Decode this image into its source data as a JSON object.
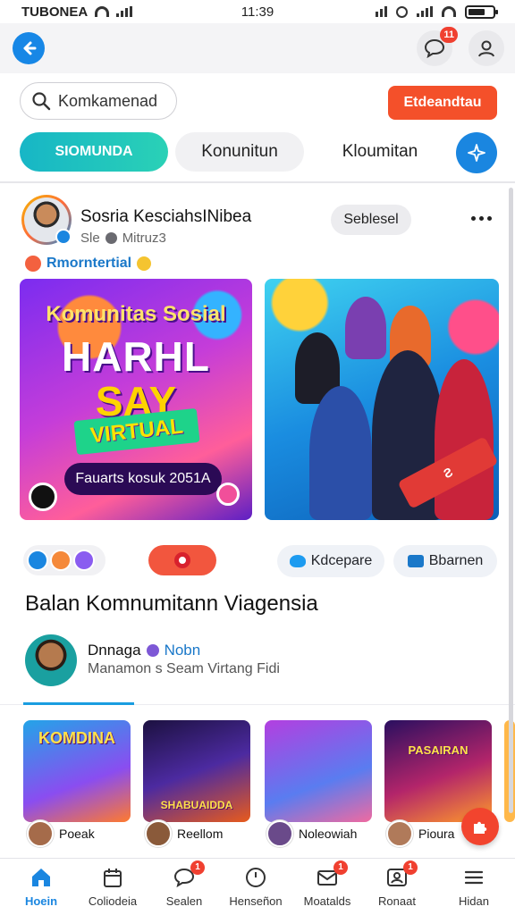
{
  "status_bar": {
    "carrier": "TUBONEA",
    "time": "11:39"
  },
  "header": {
    "notification_count": "11"
  },
  "search": {
    "placeholder": "Komkamenad"
  },
  "cta": {
    "label": "Etdeandtau"
  },
  "tabs": [
    {
      "label": "SIOMUNDA",
      "active": true
    },
    {
      "label": "Konunitun",
      "active": false
    },
    {
      "label": "Kloumitan",
      "active": false
    }
  ],
  "post": {
    "author": "Sosria KesciahsINibea",
    "subtitle_prefix": "Sle",
    "subtitle_suffix": "Mitruz3",
    "follow_label": "Seblesel",
    "tagline": "Rmorntertial",
    "poster": {
      "line1": "Komunitas Sosial",
      "line2": "HARHL",
      "line3": "SAY",
      "ribbon": "VIRTUAL",
      "date": "Fauarts kosuk 2051A"
    },
    "share_1": "Kdcepare",
    "share_2": "Bbarnen"
  },
  "section": {
    "title": "Balan Komnumitann Viagensia",
    "creator_name": "Dnnaga",
    "creator_handle": "Nobn",
    "creator_desc": "Manamon s Seam Virtang Fidi"
  },
  "thumbnails": [
    {
      "title": "KOMDINA",
      "user": "Poeak"
    },
    {
      "title": "SHABUAIDDA",
      "user": "Reellom"
    },
    {
      "title": "",
      "user": "Noleowiah"
    },
    {
      "title": "PASAIRAN",
      "user": "Pioura"
    }
  ],
  "bottom_nav": [
    {
      "label": "Hoein",
      "active": true,
      "badge": ""
    },
    {
      "label": "Coliodeia",
      "active": false,
      "badge": ""
    },
    {
      "label": "Sealen",
      "active": false,
      "badge": "1"
    },
    {
      "label": "Henseñon",
      "active": false,
      "badge": ""
    },
    {
      "label": "Moatalds",
      "active": false,
      "badge": "1"
    },
    {
      "label": "Ronaat",
      "active": false,
      "badge": "1"
    },
    {
      "label": "Hidan",
      "active": false,
      "badge": ""
    }
  ],
  "colors": {
    "accent": "#1a86e0",
    "cta": "#f4502a",
    "tab_active": "#17b6c6",
    "badge": "#f04030"
  },
  "icons": {
    "back": "arrow-left-icon",
    "messages": "chat-bubble-icon",
    "profile": "person-icon",
    "search": "search-icon",
    "add_tab": "sparkle-icon",
    "fab": "puzzle-icon"
  }
}
